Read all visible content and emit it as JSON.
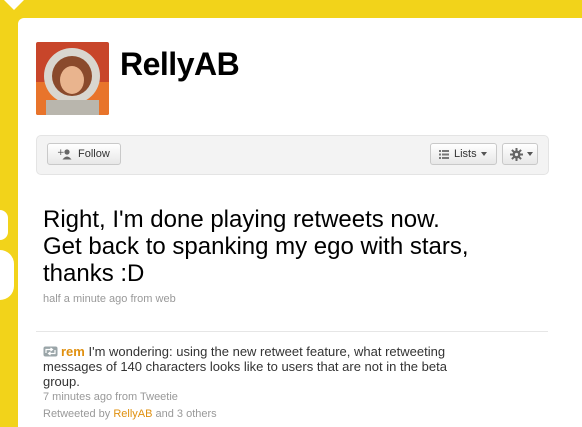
{
  "profile": {
    "username": "RellyAB"
  },
  "actions": {
    "follow_label": "Follow",
    "lists_label": "Lists"
  },
  "tweet": {
    "text": "Right, I'm done playing retweets now. Get back to spanking my ego with stars, thanks :D",
    "meta": "half a minute ago from web"
  },
  "retweet": {
    "user": "rem",
    "text": "I'm wondering: using the new retweet feature, what retweeting messages of 140 characters looks like to users that are not in the beta group.",
    "time": "7 minutes ago from Tweetie",
    "by_prefix": "Retweeted by",
    "by_user": "RellyAB",
    "by_suffix": "and 3 others"
  },
  "colors": {
    "background": "#f2d31a",
    "link": "#e0900f"
  }
}
